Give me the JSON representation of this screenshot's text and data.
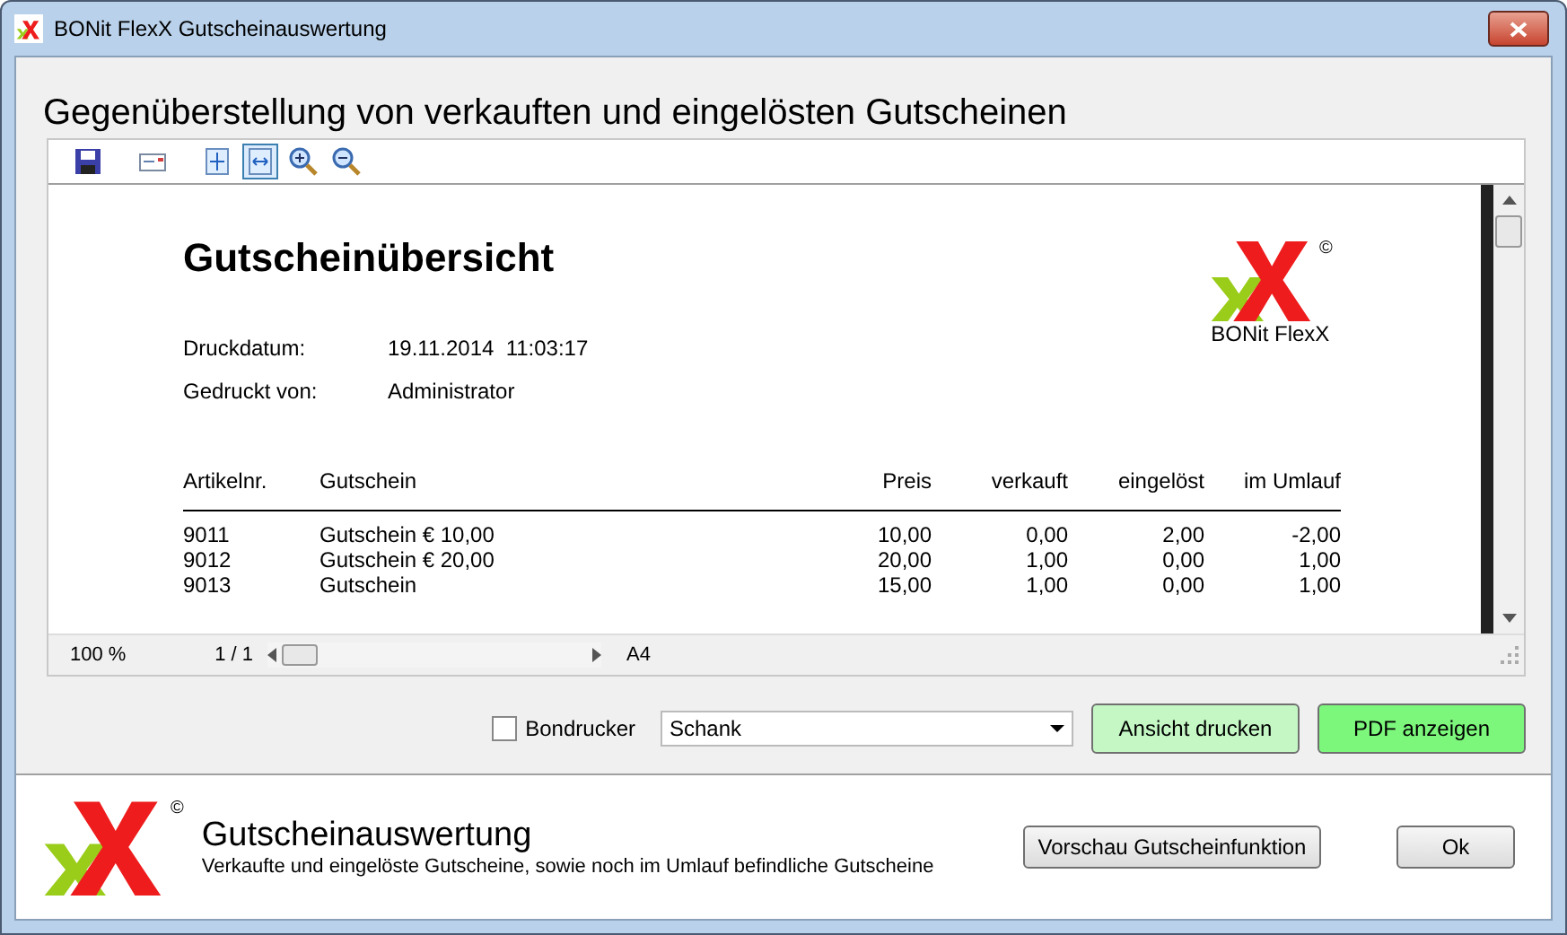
{
  "window": {
    "title": "BONit FlexX Gutscheinauswertung"
  },
  "heading": "Gegenüberstellung von verkauften und eingelösten Gutscheinen",
  "toolbar": [
    {
      "kind": "save",
      "selected": false
    },
    {
      "kind": "mail",
      "selected": false
    },
    {
      "kind": "fit-page",
      "selected": false
    },
    {
      "kind": "fit-width",
      "selected": true
    },
    {
      "kind": "zoom-in",
      "selected": false
    },
    {
      "kind": "zoom-out",
      "selected": false
    }
  ],
  "report": {
    "title": "Gutscheinübersicht",
    "logo_caption": "BONit FlexX",
    "logo_mark": "©",
    "meta": [
      {
        "label": "Druckdatum:",
        "value": "19.11.2014  11:03:17"
      },
      {
        "label": "Gedruckt von:",
        "value": "Administrator"
      }
    ],
    "columns": [
      "Artikelnr.",
      "Gutschein",
      "Preis",
      "verkauft",
      "eingelöst",
      "im Umlauf"
    ],
    "rows": [
      [
        "9011",
        "Gutschein € 10,00",
        "10,00",
        "0,00",
        "2,00",
        "-2,00"
      ],
      [
        "9012",
        "Gutschein € 20,00",
        "20,00",
        "1,00",
        "0,00",
        "1,00"
      ],
      [
        "9013",
        "Gutschein",
        "15,00",
        "1,00",
        "0,00",
        "1,00"
      ]
    ]
  },
  "status_bar": {
    "zoom": "100 %",
    "page": "1 / 1",
    "paper": "A4"
  },
  "options": {
    "bondrucker": {
      "label": "Bondrucker",
      "checked": false
    },
    "printer": "Schank",
    "buttons": [
      {
        "label": "Ansicht drucken",
        "kind": "light"
      },
      {
        "label": "PDF anzeigen",
        "kind": "strong"
      }
    ]
  },
  "footer": {
    "title": "Gutscheinauswertung",
    "subtitle": "Verkaufte und eingelöste Gutscheine, sowie noch im Umlauf befindliche Gutscheine",
    "logo_mark": "©",
    "buttons": [
      {
        "label": "Vorschau Gutscheinfunktion"
      },
      {
        "label": "Ok"
      }
    ]
  }
}
